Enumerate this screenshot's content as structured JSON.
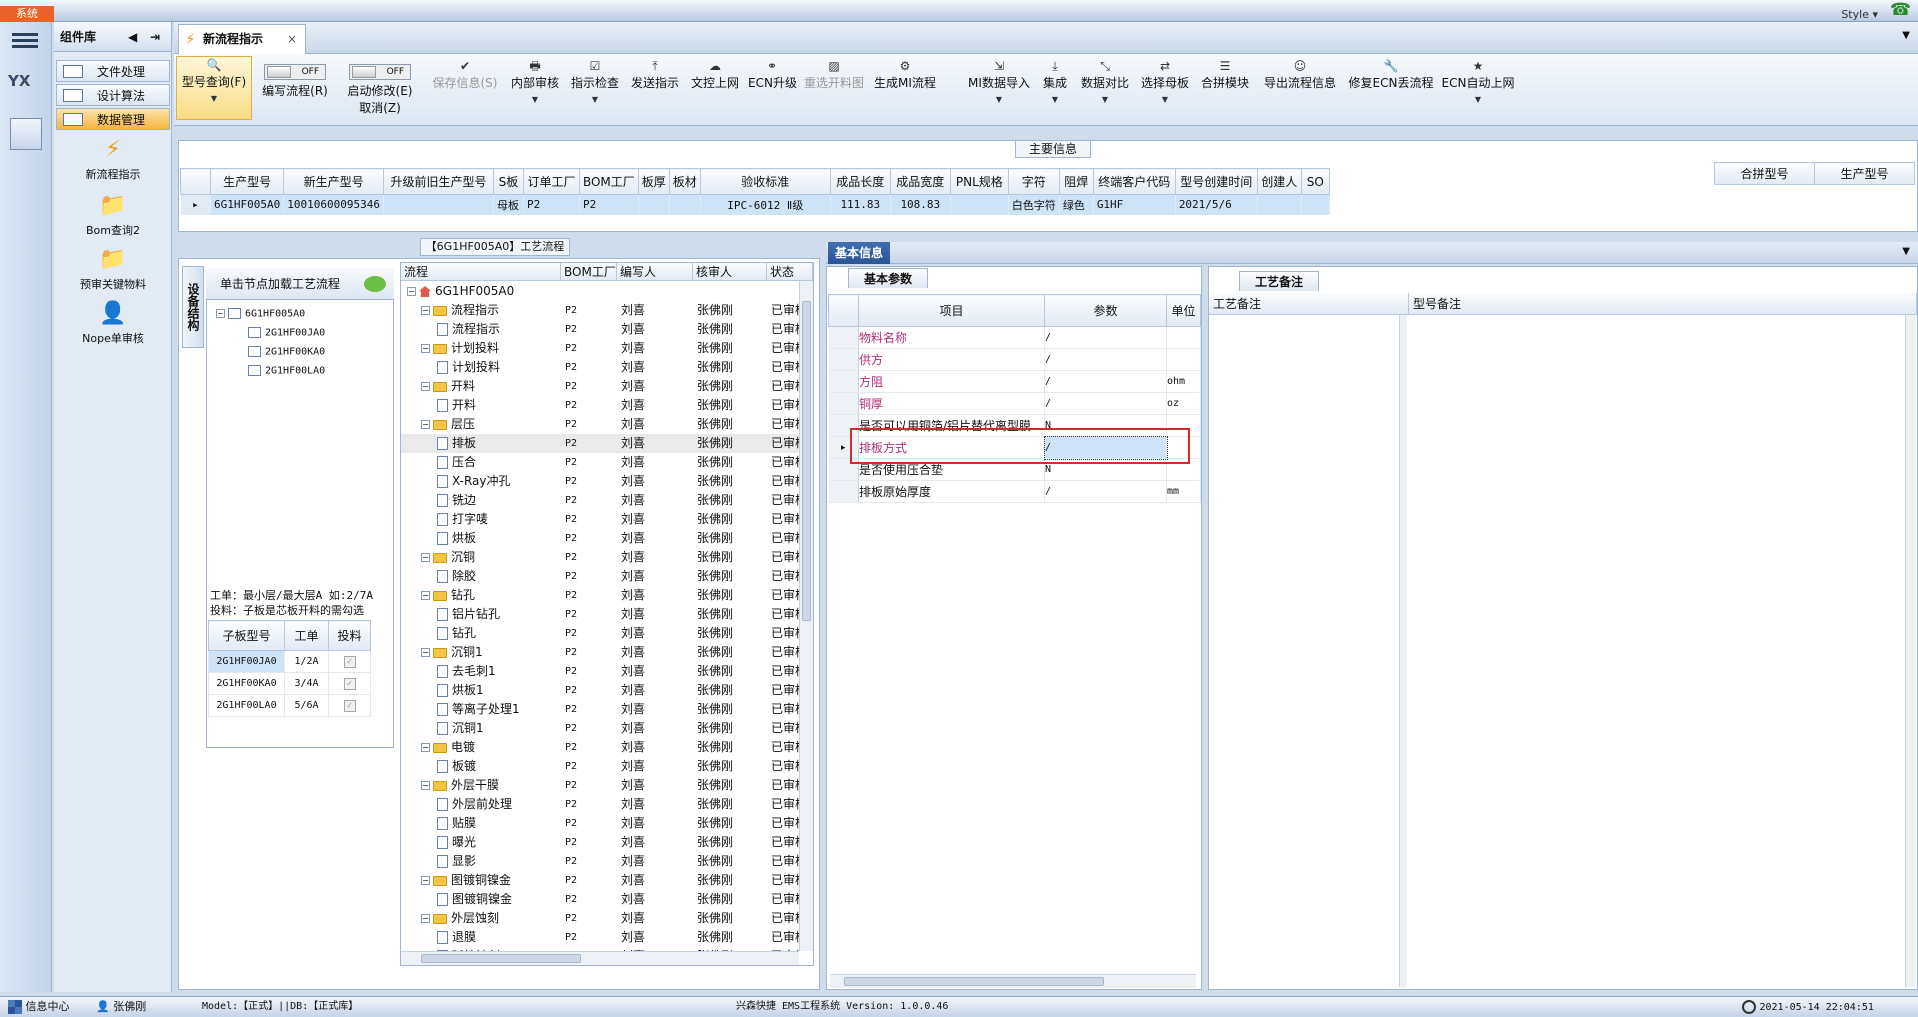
{
  "window": {
    "sys_label": "系统",
    "style_label": "Style"
  },
  "leftbar": {
    "logo_text": "YX"
  },
  "complib": {
    "title": "组件库",
    "nav": [
      "文件处理",
      "设计算法",
      "数据管理"
    ],
    "tools": [
      "新流程指示",
      "Bom查询2",
      "预审关键物料",
      "Nope单审核"
    ]
  },
  "tabs": [
    {
      "label": "新流程指示"
    }
  ],
  "ribbon": [
    {
      "label": "型号查询(F)",
      "icon": "search-icon"
    },
    {
      "label": "编写流程(R)",
      "toggle": "OFF"
    },
    {
      "label": "启动修改(E)",
      "label2": "取消(Z)",
      "toggle": "OFF"
    },
    {
      "label": "保存信息(S)",
      "icon": "check-icon",
      "disabled": true
    },
    {
      "label": "内部审核",
      "icon": "printer-icon"
    },
    {
      "label": "指示检查",
      "icon": "checkbox-icon"
    },
    {
      "label": "发送指示",
      "icon": "upload-icon"
    },
    {
      "label": "文控上网",
      "icon": "cloud-upload-icon"
    },
    {
      "label": "ECN升级",
      "icon": "binoculars-icon"
    },
    {
      "label": "重选开料图",
      "icon": "image-icon",
      "disabled": true
    },
    {
      "label": "生成MI流程",
      "icon": "cogs-icon"
    },
    {
      "label": "MI数据导入",
      "icon": "sign-in-icon"
    },
    {
      "label": "集成",
      "icon": "download-icon"
    },
    {
      "label": "数据对比",
      "icon": "compress-icon"
    },
    {
      "label": "选择母板",
      "icon": "random-icon"
    },
    {
      "label": "合拼模块",
      "icon": "list-icon"
    },
    {
      "label": "导出流程信息",
      "icon": "smile-icon"
    },
    {
      "label": "修复ECN丢流程",
      "icon": "wrench-icon"
    },
    {
      "label": "ECN自动上网",
      "icon": "star-icon"
    }
  ],
  "main_info": {
    "title": "主要信息",
    "columns": [
      "生产型号",
      "新生产型号",
      "升级前旧生产型号",
      "S板",
      "订单工厂",
      "BOM工厂",
      "板厚",
      "板材",
      "验收标准",
      "成品长度",
      "成品宽度",
      "PNL规格",
      "字符",
      "阻焊",
      "终端客户代码",
      "型号创建时间",
      "创建人",
      "SO"
    ],
    "row": [
      "6G1HF005A0",
      "10010600095346",
      "",
      "母板",
      "P2",
      "P2",
      "",
      "",
      "IPC-6012 Ⅱ级",
      "111.83",
      "108.83",
      "",
      "白色字符",
      "绿色",
      "G1HF",
      "2021/5/6",
      "",
      ""
    ],
    "merge_columns": [
      "合拼型号",
      "生产型号"
    ]
  },
  "process": {
    "title": "【6G1HF005A0】工艺流程",
    "vtab": "设备结构",
    "node_header": "单击节点加载工艺流程",
    "node_root": "6G1HF005A0",
    "node_children": [
      "2G1HF00JA0",
      "2G1HF00KA0",
      "2G1HF00LA0"
    ],
    "note1": "工单：最小层/最大层A 如:2/7A",
    "note2": "投料：子板是芯板开料的需勾选",
    "sub_columns": [
      "子板型号",
      "工单",
      "投料"
    ],
    "sub_rows": [
      {
        "model": "2G1HF00JA0",
        "order": "1/2A"
      },
      {
        "model": "2G1HF00KA0",
        "order": "3/4A"
      },
      {
        "model": "2G1HF00LA0",
        "order": "5/6A"
      }
    ],
    "grid_columns": [
      "流程",
      "BOM工厂",
      "编写人",
      "核审人",
      "状态"
    ],
    "grid_rows": [
      {
        "name": "6G1HF005A0",
        "lvl": 0,
        "t": "root",
        "f": "",
        "w": "",
        "r": "",
        "s": ""
      },
      {
        "name": "流程指示",
        "lvl": 1,
        "t": "folder",
        "f": "P2",
        "w": "刘喜",
        "r": "张佛刚",
        "s": "已审核"
      },
      {
        "name": "流程指示",
        "lvl": 2,
        "t": "doc",
        "f": "P2",
        "w": "刘喜",
        "r": "张佛刚",
        "s": "已审核"
      },
      {
        "name": "计划投料",
        "lvl": 1,
        "t": "folder",
        "f": "P2",
        "w": "刘喜",
        "r": "张佛刚",
        "s": "已审核"
      },
      {
        "name": "计划投料",
        "lvl": 2,
        "t": "doc",
        "f": "P2",
        "w": "刘喜",
        "r": "张佛刚",
        "s": "已审核"
      },
      {
        "name": "开料",
        "lvl": 1,
        "t": "folder",
        "f": "P2",
        "w": "刘喜",
        "r": "张佛刚",
        "s": "已审核"
      },
      {
        "name": "开料",
        "lvl": 2,
        "t": "doc",
        "f": "P2",
        "w": "刘喜",
        "r": "张佛刚",
        "s": "已审核"
      },
      {
        "name": "层压",
        "lvl": 1,
        "t": "folder",
        "f": "P2",
        "w": "刘喜",
        "r": "张佛刚",
        "s": "已审核"
      },
      {
        "name": "排板",
        "lvl": 2,
        "t": "doc",
        "f": "P2",
        "w": "刘喜",
        "r": "张佛刚",
        "s": "已审核",
        "sel": true
      },
      {
        "name": "压合",
        "lvl": 2,
        "t": "doc",
        "f": "P2",
        "w": "刘喜",
        "r": "张佛刚",
        "s": "已审核"
      },
      {
        "name": "X-Ray冲孔",
        "lvl": 2,
        "t": "doc",
        "f": "P2",
        "w": "刘喜",
        "r": "张佛刚",
        "s": "已审核"
      },
      {
        "name": "铣边",
        "lvl": 2,
        "t": "doc",
        "f": "P2",
        "w": "刘喜",
        "r": "张佛刚",
        "s": "已审核"
      },
      {
        "name": "打字唛",
        "lvl": 2,
        "t": "doc",
        "f": "P2",
        "w": "刘喜",
        "r": "张佛刚",
        "s": "已审核"
      },
      {
        "name": "烘板",
        "lvl": 2,
        "t": "doc",
        "f": "P2",
        "w": "刘喜",
        "r": "张佛刚",
        "s": "已审核"
      },
      {
        "name": "沉铜",
        "lvl": 1,
        "t": "folder",
        "f": "P2",
        "w": "刘喜",
        "r": "张佛刚",
        "s": "已审核"
      },
      {
        "name": "除胶",
        "lvl": 2,
        "t": "doc",
        "f": "P2",
        "w": "刘喜",
        "r": "张佛刚",
        "s": "已审核"
      },
      {
        "name": "钻孔",
        "lvl": 1,
        "t": "folder",
        "f": "P2",
        "w": "刘喜",
        "r": "张佛刚",
        "s": "已审核"
      },
      {
        "name": "铝片钻孔",
        "lvl": 2,
        "t": "doc",
        "f": "P2",
        "w": "刘喜",
        "r": "张佛刚",
        "s": "已审核"
      },
      {
        "name": "钻孔",
        "lvl": 2,
        "t": "doc",
        "f": "P2",
        "w": "刘喜",
        "r": "张佛刚",
        "s": "已审核"
      },
      {
        "name": "沉铜1",
        "lvl": 1,
        "t": "folder",
        "f": "P2",
        "w": "刘喜",
        "r": "张佛刚",
        "s": "已审核"
      },
      {
        "name": "去毛刺1",
        "lvl": 2,
        "t": "doc",
        "f": "P2",
        "w": "刘喜",
        "r": "张佛刚",
        "s": "已审核"
      },
      {
        "name": "烘板1",
        "lvl": 2,
        "t": "doc",
        "f": "P2",
        "w": "刘喜",
        "r": "张佛刚",
        "s": "已审核"
      },
      {
        "name": "等离子处理1",
        "lvl": 2,
        "t": "doc",
        "f": "P2",
        "w": "刘喜",
        "r": "张佛刚",
        "s": "已审核"
      },
      {
        "name": "沉铜1",
        "lvl": 2,
        "t": "doc",
        "f": "P2",
        "w": "刘喜",
        "r": "张佛刚",
        "s": "已审核"
      },
      {
        "name": "电镀",
        "lvl": 1,
        "t": "folder",
        "f": "P2",
        "w": "刘喜",
        "r": "张佛刚",
        "s": "已审核"
      },
      {
        "name": "板镀",
        "lvl": 2,
        "t": "doc",
        "f": "P2",
        "w": "刘喜",
        "r": "张佛刚",
        "s": "已审核"
      },
      {
        "name": "外层干膜",
        "lvl": 1,
        "t": "folder",
        "f": "P2",
        "w": "刘喜",
        "r": "张佛刚",
        "s": "已审核"
      },
      {
        "name": "外层前处理",
        "lvl": 2,
        "t": "doc",
        "f": "P2",
        "w": "刘喜",
        "r": "张佛刚",
        "s": "已审核"
      },
      {
        "name": "贴膜",
        "lvl": 2,
        "t": "doc",
        "f": "P2",
        "w": "刘喜",
        "r": "张佛刚",
        "s": "已审核"
      },
      {
        "name": "曝光",
        "lvl": 2,
        "t": "doc",
        "f": "P2",
        "w": "刘喜",
        "r": "张佛刚",
        "s": "已审核"
      },
      {
        "name": "显影",
        "lvl": 2,
        "t": "doc",
        "f": "P2",
        "w": "刘喜",
        "r": "张佛刚",
        "s": "已审核"
      },
      {
        "name": "图镀铜镍金",
        "lvl": 1,
        "t": "folder",
        "f": "P2",
        "w": "刘喜",
        "r": "张佛刚",
        "s": "已审核"
      },
      {
        "name": "图镀铜镍金",
        "lvl": 2,
        "t": "doc",
        "f": "P2",
        "w": "刘喜",
        "r": "张佛刚",
        "s": "已审核"
      },
      {
        "name": "外层蚀刻",
        "lvl": 1,
        "t": "folder",
        "f": "P2",
        "w": "刘喜",
        "r": "张佛刚",
        "s": "已审核"
      },
      {
        "name": "退膜",
        "lvl": 2,
        "t": "doc",
        "f": "P2",
        "w": "刘喜",
        "r": "张佛刚",
        "s": "已审核"
      },
      {
        "name": "碱性蚀刻",
        "lvl": 2,
        "t": "doc",
        "f": "P2",
        "w": "刘喜",
        "r": "张佛刚",
        "s": "已审核"
      }
    ]
  },
  "basic": {
    "tab": "基本信息",
    "subtab": "基本参数",
    "columns": [
      "项目",
      "参数",
      "单位"
    ],
    "rows": [
      {
        "item": "物料名称",
        "value": "/",
        "unit": "",
        "colored": true
      },
      {
        "item": "供方",
        "value": "/",
        "unit": "",
        "colored": true
      },
      {
        "item": "方阻",
        "value": "/",
        "unit": "ohm",
        "colored": true
      },
      {
        "item": "铜厚",
        "value": "/",
        "unit": "oz",
        "colored": true
      },
      {
        "item": "是否可以用铜箔/铝片替代离型膜",
        "value": "N",
        "unit": "",
        "colored": false
      },
      {
        "item": "排板方式",
        "value": "/",
        "unit": "",
        "colored": true,
        "selected": true
      },
      {
        "item": "是否使用压合垫",
        "value": "N",
        "unit": "",
        "colored": false
      },
      {
        "item": "排板原始厚度",
        "value": "/",
        "unit": "mm",
        "colored": false
      }
    ]
  },
  "remark": {
    "tab": "工艺备注",
    "col1": "工艺备注",
    "col2": "型号备注"
  },
  "statusbar": {
    "info_center": "信息中心",
    "user": "张佛刚",
    "model_db": "Model:【正式】||DB:【正式库】",
    "app": "兴森快捷 EMS工程系统 Version: 1.0.0.46",
    "time": "2021-05-14 22:04:51"
  },
  "colors": {
    "accent": "#2a5596",
    "highlight": "#f5b53f",
    "alert": "#d62a2a",
    "key_text": "#b0307a"
  }
}
